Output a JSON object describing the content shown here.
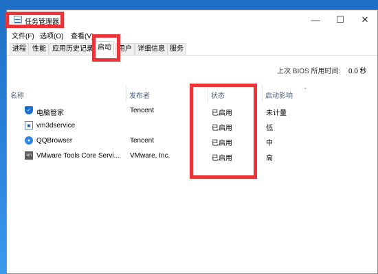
{
  "window": {
    "title": "任务管理器",
    "controls": {
      "minimize": "—",
      "maximize": "☐",
      "close": "✕"
    }
  },
  "menu": [
    "文件(F)",
    "选项(O)",
    "查看(V)"
  ],
  "tabs": [
    "进程",
    "性能",
    "应用历史记录",
    "启动",
    "用户",
    "详细信息",
    "服务"
  ],
  "active_tab": "启动",
  "boot": {
    "label": "上次 BIOS 所用时间:",
    "value": "0.0 秒"
  },
  "columns": {
    "name": "名称",
    "publisher": "发布者",
    "status": "状态",
    "impact": "启动影响"
  },
  "rows": [
    {
      "name": "电脑管家",
      "publisher": "Tencent",
      "status": "已启用",
      "impact": "未计量",
      "icon": "shield-icon"
    },
    {
      "name": "vm3dservice",
      "publisher": "",
      "status": "已启用",
      "impact": "低",
      "icon": "vm-service-icon"
    },
    {
      "name": "QQBrowser",
      "publisher": "Tencent",
      "status": "已启用",
      "impact": "中",
      "icon": "qqbrowser-icon"
    },
    {
      "name": "VMware Tools Core Servi...",
      "publisher": "VMware, Inc.",
      "status": "已启用",
      "impact": "高",
      "icon": "vmware-icon"
    }
  ],
  "highlight_color": "#e9353a"
}
